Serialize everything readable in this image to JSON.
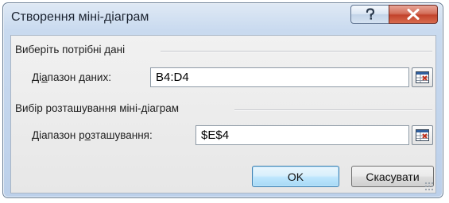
{
  "window": {
    "title": "Створення міні-діаграм"
  },
  "title_buttons": {
    "help_icon": "question-icon",
    "close_icon": "close-icon"
  },
  "data_group": {
    "title": "Виберіть потрібні дані",
    "range_label_pre": "Ді",
    "range_label_u": "а",
    "range_label_post": "пазон даних:",
    "range_value": "B4:D4"
  },
  "location_group": {
    "title": "Вибір розташування міні-діаграм",
    "range_label_pre": "Діапазон р",
    "range_label_u": "о",
    "range_label_post": "зташування:",
    "range_value": "$E$4"
  },
  "buttons": {
    "ok": "OK",
    "cancel": "Скасувати"
  },
  "colors": {
    "accent": "#3c7fb1",
    "close": "#c2432c"
  }
}
